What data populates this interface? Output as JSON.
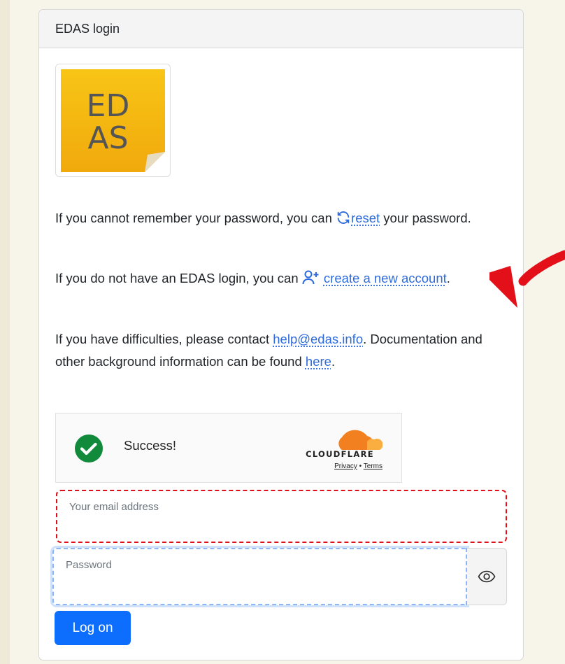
{
  "card": {
    "title": "EDAS login"
  },
  "logo": {
    "line1": "ED",
    "line2": "AS"
  },
  "paragraphs": {
    "reset": {
      "before": "If you cannot remember your password, you can ",
      "link": "reset",
      "after": " your password."
    },
    "create": {
      "before": "If you do not have an EDAS login, you can ",
      "link": "create a new account",
      "after": "."
    },
    "help": {
      "before": "If you have difficulties, please contact ",
      "email": "help@edas.info",
      "middle": ". Documentation and other background information can be found ",
      "here": "here",
      "after": "."
    }
  },
  "turnstile": {
    "status": "Success!",
    "brand": "CLOUDFLARE",
    "privacy": "Privacy",
    "separator": " • ",
    "terms": "Terms"
  },
  "form": {
    "email_placeholder": "Your email address",
    "password_placeholder": "Password",
    "submit_label": "Log on"
  },
  "colors": {
    "primary": "#0d6efd",
    "link": "#2d6bdc",
    "highlight": "#e0101a",
    "logo": "#f5b800"
  },
  "icons": {
    "reset": "refresh-icon",
    "create": "person-add-icon",
    "eye": "eye-icon",
    "check": "check-circle-icon",
    "annotation": "curved-arrow-icon"
  }
}
